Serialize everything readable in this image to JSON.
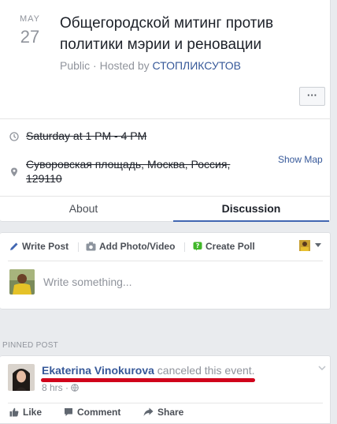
{
  "event": {
    "month": "MAY",
    "day": "27",
    "title": "Общегородской митинг против политики мэрии и реновации",
    "visibility": "Public",
    "meta_separator": " · ",
    "hosted_by_prefix": "Hosted by ",
    "host": "СТОПЛИКСУТОВ",
    "more_label": "···",
    "time": "Saturday at 1 PM - 4 PM",
    "location_line1": "Суворовская площадь, Москва, Россия,",
    "location_line2": "129110",
    "show_map": "Show Map"
  },
  "tabs": [
    {
      "label": "About",
      "active": false
    },
    {
      "label": "Discussion",
      "active": true
    }
  ],
  "composer": {
    "actions": [
      {
        "label": "Write Post",
        "icon": "pencil-icon"
      },
      {
        "label": "Add Photo/Video",
        "icon": "camera-icon"
      },
      {
        "label": "Create Poll",
        "icon": "poll-icon"
      }
    ],
    "placeholder": "Write something..."
  },
  "pinned": {
    "section_label": "PINNED POST",
    "author": "Ekaterina Vinokurova",
    "action": " canceled this event.",
    "time": "8 hrs · ",
    "buttons": [
      "Like",
      "Comment",
      "Share"
    ]
  },
  "colors": {
    "link": "#365899",
    "accent": "#4267b2",
    "highlight": "#d0021b"
  }
}
